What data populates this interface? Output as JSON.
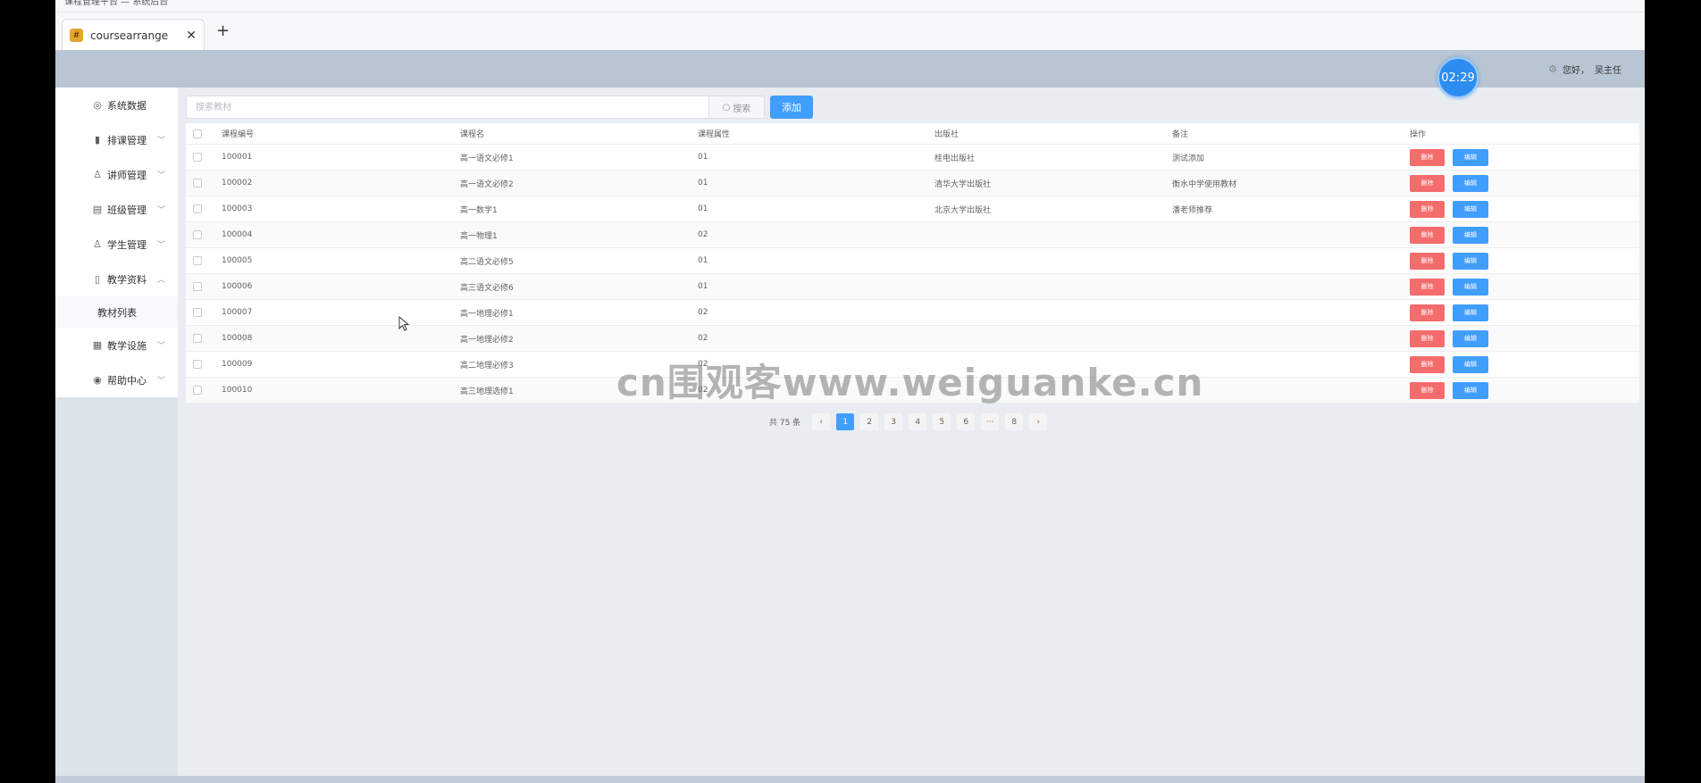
{
  "browser": {
    "title_text": "课程管理平台 — 系统后台",
    "tab_title": "coursearrange",
    "tab_close": "✕",
    "new_tab": "+"
  },
  "header": {
    "timer": "02:29",
    "greeting": "您好，",
    "user": "吴主任"
  },
  "sidebar": {
    "items": [
      {
        "label": "系统数据",
        "icon": "dashboard-icon",
        "glyph": "◎"
      },
      {
        "label": "排课管理",
        "icon": "bar-chart-icon",
        "glyph": "▮"
      },
      {
        "label": "讲师管理",
        "icon": "user-icon",
        "glyph": "♙"
      },
      {
        "label": "班级管理",
        "icon": "class-icon",
        "glyph": "▤"
      },
      {
        "label": "学生管理",
        "icon": "user-icon",
        "glyph": "♙"
      },
      {
        "label": "教学资料",
        "icon": "book-icon",
        "glyph": "▯"
      },
      {
        "label": "教学设施",
        "icon": "building-icon",
        "glyph": "▦"
      },
      {
        "label": "帮助中心",
        "icon": "help-icon",
        "glyph": "◉"
      }
    ],
    "sub_item": "教材列表"
  },
  "toolbar": {
    "search_placeholder": "搜索教材",
    "search_label": "搜索",
    "add_label": "添加"
  },
  "table": {
    "headers": [
      "课程编号",
      "课程名",
      "课程属性",
      "出版社",
      "备注",
      "操作"
    ],
    "delete_label": "删除",
    "edit_label": "编辑",
    "rows": [
      {
        "id": "100001",
        "name": "高一语文必修1",
        "attr": "01",
        "publisher": "桂电出版社",
        "note": "测试添加"
      },
      {
        "id": "100002",
        "name": "高一语文必修2",
        "attr": "01",
        "publisher": "清华大学出版社",
        "note": "衡水中学使用教材"
      },
      {
        "id": "100003",
        "name": "高一数学1",
        "attr": "01",
        "publisher": "北京大学出版社",
        "note": "潘老师推荐"
      },
      {
        "id": "100004",
        "name": "高一物理1",
        "attr": "02",
        "publisher": "",
        "note": ""
      },
      {
        "id": "100005",
        "name": "高二语文必修5",
        "attr": "01",
        "publisher": "",
        "note": ""
      },
      {
        "id": "100006",
        "name": "高三语文必修6",
        "attr": "01",
        "publisher": "",
        "note": ""
      },
      {
        "id": "100007",
        "name": "高一地理必修1",
        "attr": "02",
        "publisher": "",
        "note": ""
      },
      {
        "id": "100008",
        "name": "高一地理必修2",
        "attr": "02",
        "publisher": "",
        "note": ""
      },
      {
        "id": "100009",
        "name": "高二地理必修3",
        "attr": "02",
        "publisher": "",
        "note": ""
      },
      {
        "id": "100010",
        "name": "高三地理选修1",
        "attr": "02",
        "publisher": "",
        "note": ""
      }
    ]
  },
  "pagination": {
    "total": "共 75 条",
    "prev": "‹",
    "next": "›",
    "pages": [
      "1",
      "2",
      "3",
      "4",
      "5",
      "6",
      "···",
      "8"
    ],
    "current": "1"
  },
  "watermark": "cn围观客www.weiguanke.cn"
}
